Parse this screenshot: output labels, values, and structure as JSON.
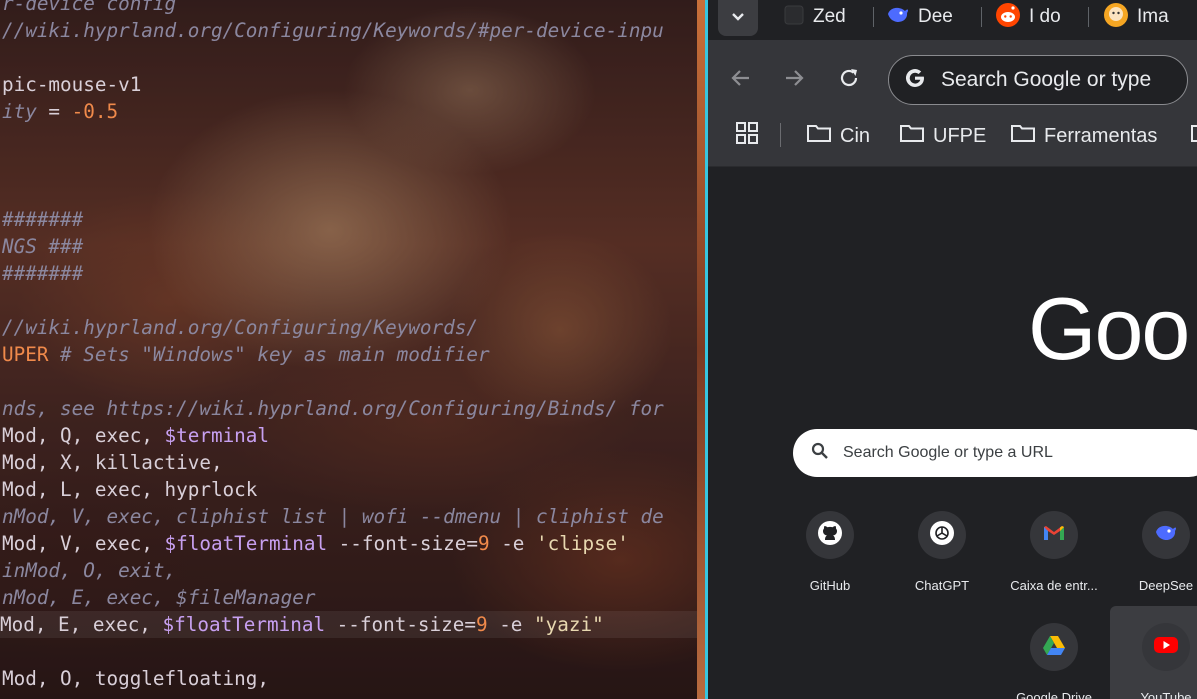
{
  "terminal": {
    "lines": [
      {
        "segments": [
          {
            "t": "r-device config",
            "c": "c-com"
          }
        ]
      },
      {
        "segments": [
          {
            "t": "//wiki.hyprland.org/Configuring/Keywords/#per-device-inpu",
            "c": "c-com"
          }
        ]
      },
      {
        "segments": []
      },
      {
        "segments": [
          {
            "t": "pic-mouse-v1",
            "c": ""
          }
        ]
      },
      {
        "segments": [
          {
            "t": "ity",
            "c": "c-com"
          },
          {
            "t": " = ",
            "c": ""
          },
          {
            "t": "-0.5",
            "c": "c-org"
          }
        ]
      },
      {
        "segments": []
      },
      {
        "segments": []
      },
      {
        "segments": []
      },
      {
        "segments": [
          {
            "t": "#######",
            "c": "c-com"
          }
        ]
      },
      {
        "segments": [
          {
            "t": "NGS ###",
            "c": "c-com"
          }
        ]
      },
      {
        "segments": [
          {
            "t": "#######",
            "c": "c-com"
          }
        ]
      },
      {
        "segments": []
      },
      {
        "segments": [
          {
            "t": "//wiki.hyprland.org/Configuring/Keywords/",
            "c": "c-com"
          }
        ]
      },
      {
        "segments": [
          {
            "t": "UPER",
            "c": "c-org"
          },
          {
            "t": " # Sets \"Windows\" key as main modifier",
            "c": "c-com"
          }
        ]
      },
      {
        "segments": []
      },
      {
        "segments": [
          {
            "t": "nds, see https://wiki.hyprland.org/Configuring/Binds/ for ",
            "c": "c-com"
          }
        ]
      },
      {
        "segments": [
          {
            "t": "Mod, Q, exec, ",
            "c": ""
          },
          {
            "t": "$terminal",
            "c": "c-pur"
          }
        ]
      },
      {
        "segments": [
          {
            "t": "Mod, X, killactive,",
            "c": ""
          }
        ]
      },
      {
        "segments": [
          {
            "t": "Mod, L, exec, hyprlock",
            "c": ""
          }
        ]
      },
      {
        "segments": [
          {
            "t": "nMod, V, exec, cliphist list | wofi --dmenu | cliphist de",
            "c": "c-com"
          }
        ]
      },
      {
        "segments": [
          {
            "t": "Mod, V, exec, ",
            "c": ""
          },
          {
            "t": "$floatTerminal",
            "c": "c-pur"
          },
          {
            "t": " --font-size=",
            "c": ""
          },
          {
            "t": "9",
            "c": "c-org"
          },
          {
            "t": " -e ",
            "c": ""
          },
          {
            "t": "'clipse'",
            "c": "c-grn"
          }
        ]
      },
      {
        "segments": [
          {
            "t": "inMod, O, exit,",
            "c": "c-com"
          }
        ]
      },
      {
        "segments": [
          {
            "t": "nMod, E, exec, $fileManager",
            "c": "c-com"
          }
        ]
      },
      {
        "segments": [
          {
            "t": "Mod, E, exec, ",
            "c": ""
          },
          {
            "t": "$floatTerminal",
            "c": "c-pur"
          },
          {
            "t": " --font-size=",
            "c": ""
          },
          {
            "t": "9",
            "c": "c-org"
          },
          {
            "t": " -e ",
            "c": ""
          },
          {
            "t": "\"yazi\"",
            "c": "c-grn"
          }
        ],
        "highlight": true
      },
      {
        "segments": []
      },
      {
        "segments": [
          {
            "t": "Mod, O, togglefloating,",
            "c": ""
          }
        ]
      }
    ]
  },
  "browser": {
    "tabs": [
      {
        "label": "Zed",
        "icon": "zed-icon"
      },
      {
        "label": "Dee",
        "icon": "deepseek-icon"
      },
      {
        "label": "I do",
        "icon": "reddit-icon"
      },
      {
        "label": "Ima",
        "icon": "image-app-icon"
      }
    ],
    "omnibox": {
      "text": "Search Google or type"
    },
    "bookmarks": [
      {
        "label": "Cin"
      },
      {
        "label": "UFPE"
      },
      {
        "label": "Ferramentas"
      }
    ],
    "ntp": {
      "logo": "Goo",
      "search_placeholder": "Search Google or type a URL",
      "shortcuts": [
        {
          "label": "GitHub",
          "icon": "github-icon"
        },
        {
          "label": "ChatGPT",
          "icon": "chatgpt-icon"
        },
        {
          "label": "Caixa de entr...",
          "icon": "gmail-icon"
        },
        {
          "label": "DeepSee",
          "icon": "deepseek-icon"
        },
        {
          "label": "Google Drive",
          "icon": "google-drive-icon"
        },
        {
          "label": "YouTube",
          "icon": "youtube-icon"
        }
      ]
    },
    "colors": {
      "accent_border": "#37c6e0",
      "browser_bg": "#202124",
      "toolbar_bg": "#35363a"
    }
  }
}
